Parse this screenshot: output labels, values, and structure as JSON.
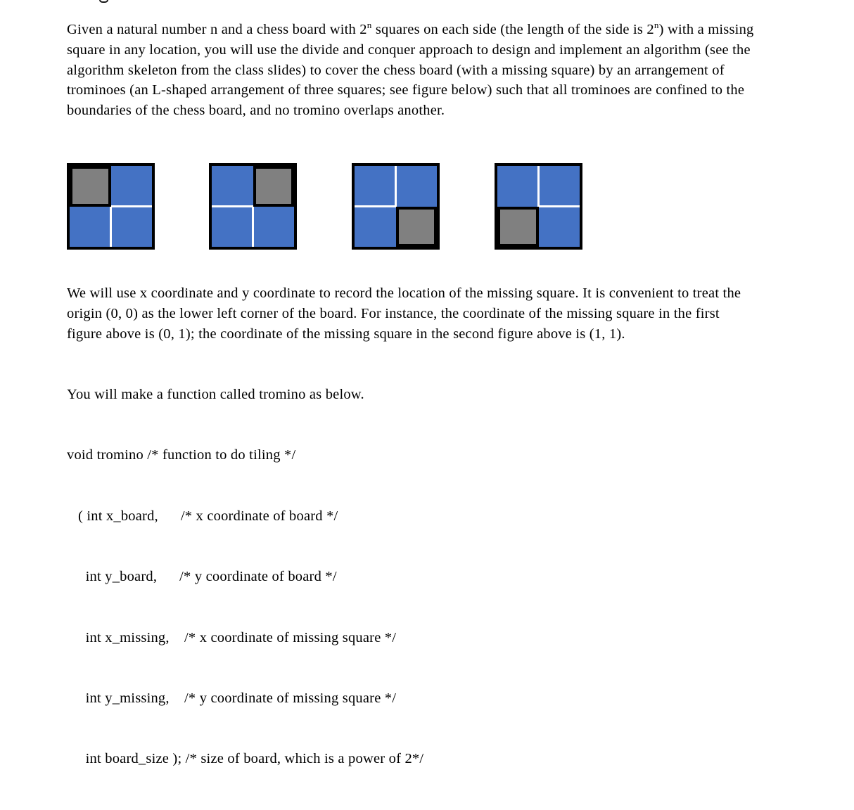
{
  "document": {
    "paragraph_1": {
      "segment_a": "Given a natural number n and a chess board with 2",
      "exponent_1": "n",
      "segment_b": " squares on each side (the length of the side is 2",
      "exponent_2": "n",
      "segment_c": ") with a missing square in any location, you will use the divide and conquer approach to design and implement an algorithm (see the algorithm skeleton from the class slides) to cover the chess board (with a missing square) by an arrangement of trominoes (an L-shaped arrangement of three squares; see figure below) such that all trominoes are confined to the boundaries of the chess board, and no tromino overlaps another."
    },
    "paragraph_2": "We will use x coordinate and y coordinate to record the location of the missing square. It is convenient to treat the origin (0, 0) as the lower left corner of the board. For instance, the coordinate of the missing square in the first figure above is (0, 1); the coordinate of the missing square in the second figure above is (1, 1).",
    "paragraph_3_intro": "You will make a function called tromino as below.",
    "code_lines": [
      "void tromino /* function to do tiling */",
      "   ( int x_board,      /* x coordinate of board */",
      "     int y_board,      /* y coordinate of board */",
      "     int x_missing,    /* x coordinate of missing square */",
      "     int y_missing,    /* y coordinate of missing square */",
      "     int board_size ); /* size of board, which is a power of 2*/"
    ]
  },
  "figures": {
    "colors": {
      "blue": "#4472C4",
      "gray": "#808080",
      "border": "#000000",
      "separator": "#FFFFFF"
    },
    "items": [
      {
        "label": "figure-1",
        "missing_cell": "top-left",
        "coordinate": "(0, 1)"
      },
      {
        "label": "figure-2",
        "missing_cell": "top-right",
        "coordinate": "(1, 1)"
      },
      {
        "label": "figure-3",
        "missing_cell": "bottom-right",
        "coordinate": "(1, 0)"
      },
      {
        "label": "figure-4",
        "missing_cell": "bottom-left",
        "coordinate": "(0, 0)"
      }
    ]
  }
}
